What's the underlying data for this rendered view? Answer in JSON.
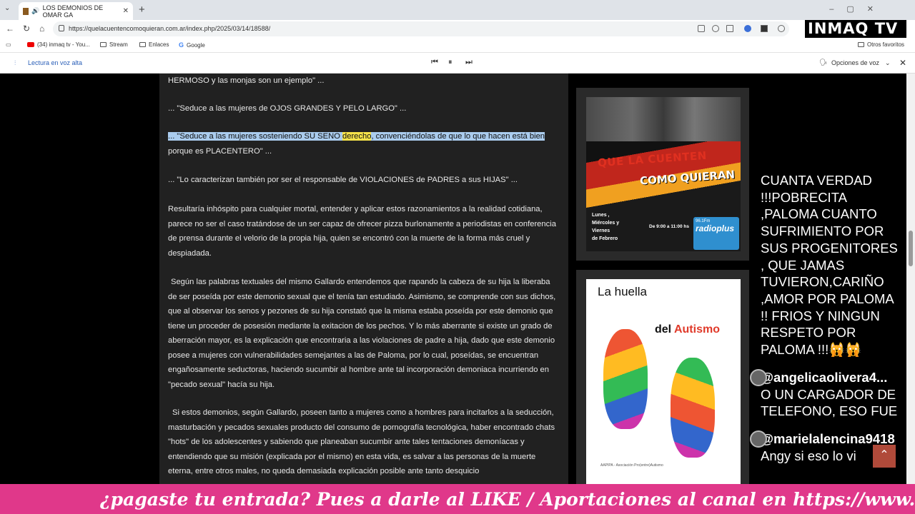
{
  "browser": {
    "tab_title": "LOS DEMONIOS DE OMAR GA",
    "url": "https://quelacuentencomoquieran.com.ar/index.php/2025/03/14/18588/"
  },
  "bookmarks": {
    "items": [
      "(34) inmaq tv - You...",
      "Stream",
      "Enlaces",
      "Google"
    ],
    "other": "Otros favoritos"
  },
  "reader": {
    "label": "Lectura en voz alta",
    "voice_options": "Opciones de voz"
  },
  "overlay_logo": "INMAQ TV",
  "article": {
    "p0": "HERMOSO y las monjas son un ejemplo\" ...",
    "p1": "... \"Seduce a las mujeres de OJOS GRANDES Y PELO LARGO\" ...",
    "p2_hl1": "... \"Seduce a las mujeres sosteniendo SU SENO ",
    "p2_hl2": "derecho",
    "p2_hl3": ", convenciéndolas de que lo que hacen está bien",
    "p2_rest": "porque es PLACENTERO\" ...",
    "p3": "... \"Lo caracterizan también por ser el responsable de VIOLACIONES de PADRES a sus HIJAS\" ...",
    "p4": "Resultaría inhóspito para cualquier mortal, entender y aplicar estos razonamientos a la realidad cotidiana, parece no ser el caso tratándose de un ser capaz de ofrecer pizza burlonamente a periodistas en conferencia de prensa durante el velorio de la propia hija, quien se encontró con la muerte de la forma más cruel y despiadada.",
    "p5": "Según las palabras textuales del mismo Gallardo entendemos que rapando la cabeza de su hija la liberaba de ser poseída por este demonio sexual que el tenía tan estudiado. Asimismo, se comprende con sus dichos, que al observar los senos y pezones de su hija constató que la misma estaba poseída por este demonio que tiene un proceder de posesión mediante la exitacion de los pechos. Y lo más aberrante si existe un grado de aberración mayor, es la explicación que encontraria a las violaciones de padre a hija, dado que este demonio posee a mujeres con vulnerabilidades semejantes a las de Paloma, por lo cual, poseídas, se encuentran engañosamente seductoras, haciendo sucumbir al hombre ante tal incorporación demoniaca incurriendo en \"pecado sexual\" hacía su hija.",
    "p6": "Si estos demonios, según Gallardo, poseen tanto a mujeres como a hombres para incitarlos a la seducción, masturbación y pecados sexuales producto del consumo de pornografía tecnológica, haber encontrado chats \"hots\" de los adolescentes y sabiendo que planeaban sucumbir ante tales tentaciones demoníacas y entendiendo que su misión (explicada por el mismo) en esta vida, es salvar a las personas de la muerte eterna, entre otros males, no queda demasiada explicación posible ante tanto desquicio"
  },
  "sidebar": {
    "banner1": {
      "title1": "QUE LA CUENTEN",
      "title2": "COMO QUIERAN",
      "days": "Lunes ,\nMiércoles y\nViernes\nde Febrero",
      "hours": "De 9:00 a 11:00 hs",
      "freq": "96.1Fm",
      "station": "radioplus"
    },
    "banner2": {
      "title1": "La huella",
      "title2_a": "del ",
      "title2_b": "Autismo",
      "footer": "AAPIPA - Asociación Pro(entre)Autismo"
    }
  },
  "chat": {
    "m1": "CUANTA VERDAD !!!POBRECITA ,PALOMA CUANTO SUFRIMIENTO POR SUS PROGENITORES , QUE JAMAS TUVIERON,CARIÑO ,AMOR POR PALOMA !! FRIOS Y NINGUN RESPETO POR PALOMA !!!🙀🙀",
    "u2": "@angelicaolivera4...",
    "m2": "O UN CARGADOR DE TELEFONO, ESO FUE",
    "u3": "@marielalencina9418",
    "m3": "Angy si eso lo vi"
  },
  "ticker": "¿pagaste tu entrada? Pues a darle al LIKE / Aportaciones al canal en https://www.paypal.me/zaragoza"
}
